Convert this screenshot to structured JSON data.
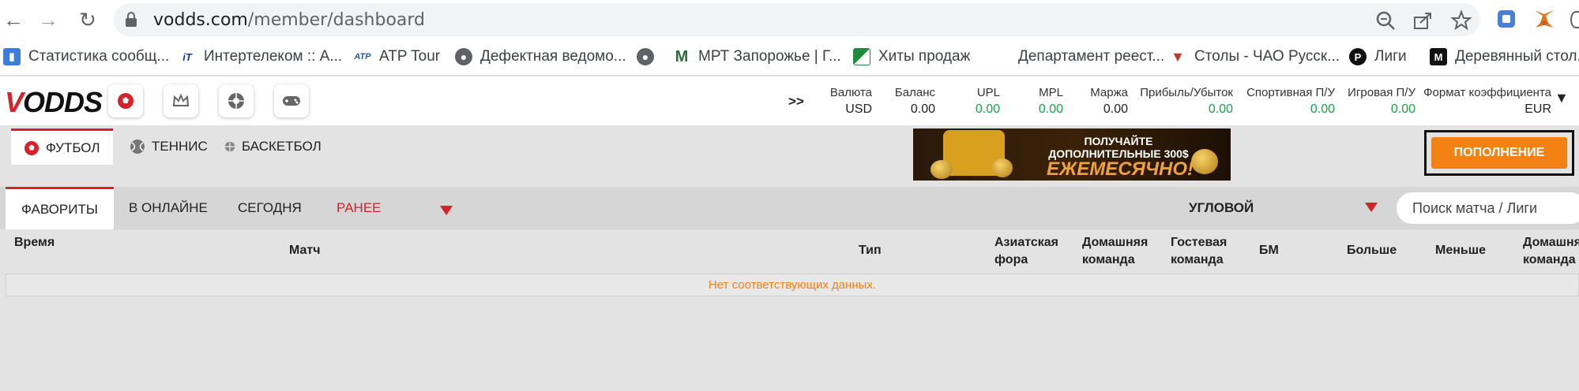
{
  "browser": {
    "url_domain": "vodds.com",
    "url_path": "/member/dashboard",
    "icons": [
      "back-icon",
      "forward-icon",
      "reload-icon",
      "lock-icon",
      "zoom-icon",
      "share-icon",
      "star-icon",
      "extension-icon",
      "metamask-icon"
    ]
  },
  "bookmarks": [
    {
      "label": "Статистика сообщ...",
      "icon": "bar-chart-icon",
      "color": "#3b7dd8"
    },
    {
      "label": "Интертелеком :: А...",
      "icon": "intertelecom-icon",
      "color": "#1a3c8f"
    },
    {
      "label": "ATP Tour",
      "icon": "atp-icon",
      "color": "#2a59a8"
    },
    {
      "label": "Дефектная ведомо...",
      "icon": "globe-icon",
      "color": "#5f6368"
    },
    {
      "label": "",
      "icon": "globe-icon",
      "color": "#5f6368"
    },
    {
      "label": "МРТ Запорожье | Г...",
      "icon": "mrt-icon",
      "color": "#2e6b3a"
    },
    {
      "label": "Хиты продаж",
      "icon": "sales-icon",
      "color": "#1d8a3c"
    },
    {
      "label": "Департамент реест...",
      "icon": "",
      "color": ""
    },
    {
      "label": "Столы - ЧАО Русск...",
      "icon": "tables-icon",
      "color": "#c0392b"
    },
    {
      "label": "Лиги",
      "icon": "p-icon",
      "color": "#111111"
    },
    {
      "label": "Деревянный стол...",
      "icon": "m-icon",
      "color": "#111111"
    }
  ],
  "header": {
    "logo": "ODDS",
    "logo_v": "V",
    "expand": ">>",
    "stats": [
      {
        "label": "Валюта",
        "value": "USD",
        "green": false
      },
      {
        "label": "Баланс",
        "value": "0.00",
        "green": false
      },
      {
        "label": "UPL",
        "value": "0.00",
        "green": true
      },
      {
        "label": "MPL",
        "value": "0.00",
        "green": true
      },
      {
        "label": "Маржа",
        "value": "0.00",
        "green": false
      },
      {
        "label": "Прибыль/Убыток",
        "value": "0.00",
        "green": true
      },
      {
        "label": "Спортивная П/У",
        "value": "0.00",
        "green": true
      },
      {
        "label": "Игровая П/У",
        "value": "0.00",
        "green": true
      },
      {
        "label": "Формат коэффициента",
        "value": "EUR",
        "green": false
      }
    ],
    "caret": "▼"
  },
  "sports_tabs": [
    {
      "label": "ФУТБОЛ",
      "icon": "football-icon",
      "active": true
    },
    {
      "label": "ТЕННИС",
      "icon": "tennis-icon",
      "active": false
    },
    {
      "label": "БАСКЕТБОЛ",
      "icon": "basketball-icon",
      "active": false
    }
  ],
  "banner": {
    "line1": "ПОЛУЧАЙТЕ",
    "line2": "ДОПОЛНИТЕЛЬНЫЕ 300$",
    "line3": "ЕЖЕМЕСЯЧНО!"
  },
  "deposit_label": "ПОПОЛНЕНИЕ",
  "filter_tabs": [
    {
      "label": "ФАВОРИТЫ",
      "active": true,
      "red": false
    },
    {
      "label": "В ОНЛАЙНЕ",
      "active": false,
      "red": false
    },
    {
      "label": "СЕГОДНЯ",
      "active": false,
      "red": false
    },
    {
      "label": "РАНЕЕ",
      "active": false,
      "red": true
    }
  ],
  "market_label": "УГЛОВОЙ",
  "search_placeholder": "Поиск матча / Лиги",
  "table": {
    "headers": {
      "time": "Время",
      "match": "Матч",
      "type": "Тип",
      "asian1": "Азиатская",
      "asian2": "фора",
      "home1": "Домашняя",
      "home2": "команда",
      "away1": "Гостевая",
      "away2": "команда",
      "bm": "БМ",
      "over": "Больше",
      "under": "Меньше",
      "home_b1": "Домашня",
      "home_b2": "команда"
    },
    "empty_message": "Нет соответствующих данных."
  },
  "colors": {
    "accent_red": "#d7222a",
    "deposit_orange": "#f48114",
    "green_value": "#1aa04b"
  }
}
